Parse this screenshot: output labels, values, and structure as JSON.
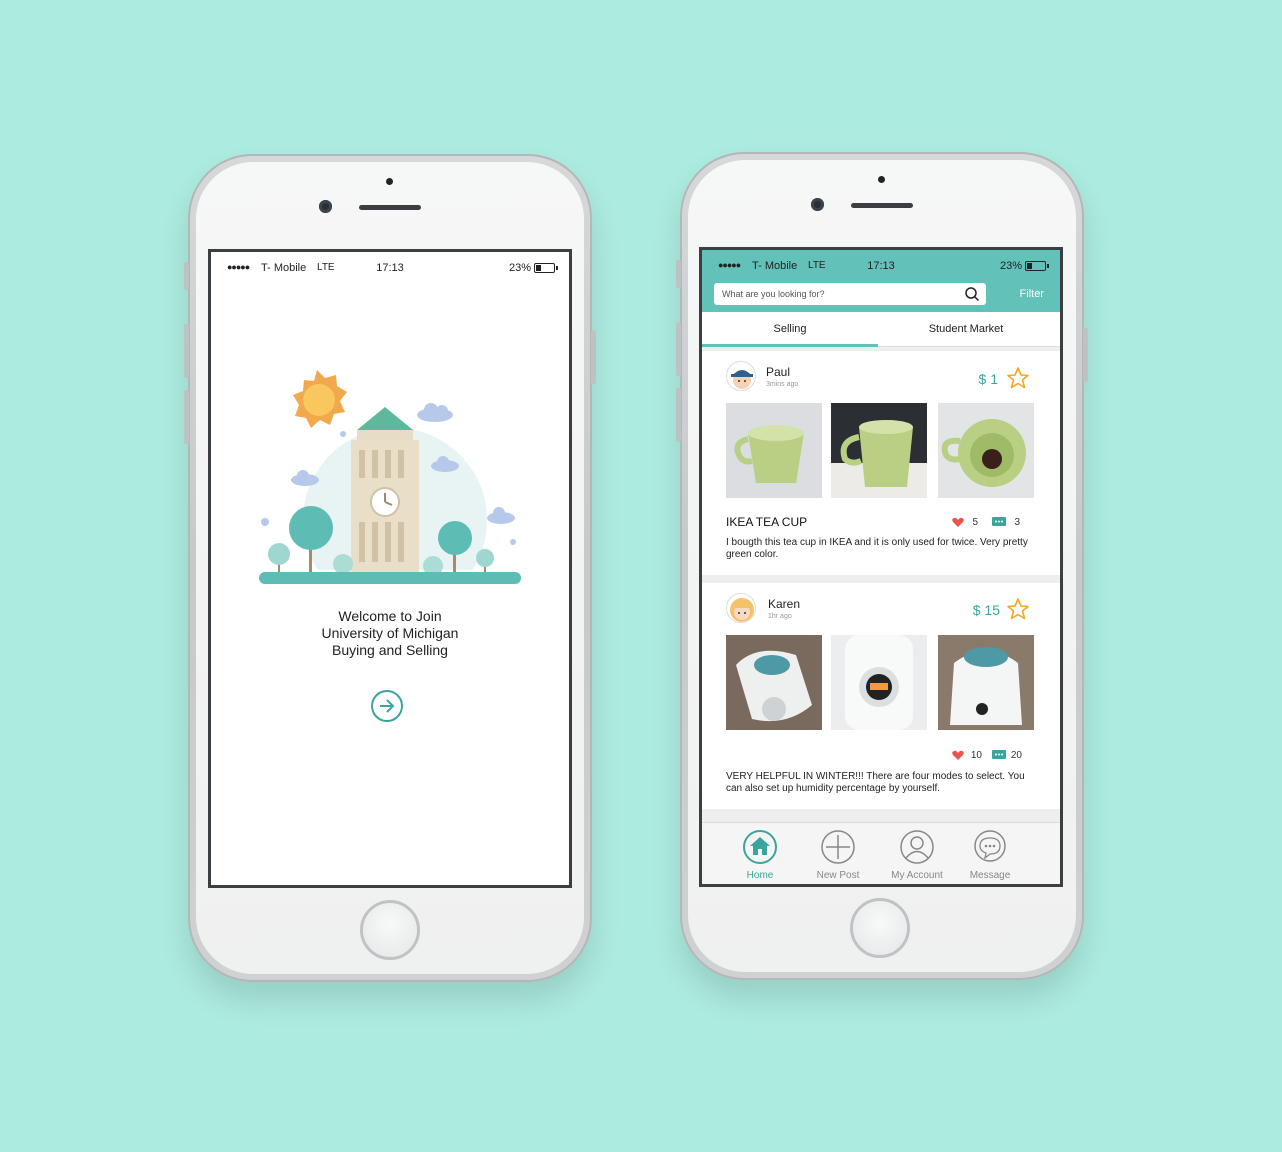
{
  "status": {
    "carrier": "T- Mobile",
    "network": "LTE",
    "time": "17:13",
    "battery": "23%"
  },
  "welcome": {
    "line1": "Welcome to Join",
    "line2": "University of Michigan",
    "line3": "Buying and Selling",
    "next_icon": "arrow-right-circle-icon"
  },
  "market": {
    "search_placeholder": "What are you looking for?",
    "filter_label": "Filter",
    "tabs": [
      {
        "label": "Selling",
        "active": true
      },
      {
        "label": "Student Market",
        "active": false
      }
    ],
    "posts": [
      {
        "user": "Paul",
        "time_ago": "3mins ago",
        "price": "$ 1",
        "title": "IKEA TEA CUP",
        "likes": "5",
        "comments": "3",
        "description": "I bougth this tea cup in IKEA and it is only used for twice. Very pretty green color."
      },
      {
        "user": "Karen",
        "time_ago": "1hr ago",
        "price": "$ 15",
        "title": "",
        "likes": "10",
        "comments": "20",
        "description": "VERY HELPFUL IN WINTER!!! There are four modes to select. You can also set up humidity percentage by yourself."
      }
    ],
    "tabbar": [
      {
        "label": "Home",
        "icon": "home-icon",
        "active": true
      },
      {
        "label": "New Post",
        "icon": "plus-circle-icon",
        "active": false
      },
      {
        "label": "My Account",
        "icon": "user-icon",
        "active": false
      },
      {
        "label": "Message",
        "icon": "chat-icon",
        "active": false
      }
    ]
  },
  "colors": {
    "background": "#acebdf",
    "accent": "#62c1b8",
    "accent_dark": "#3aa59c",
    "star": "#f5a623",
    "heart": "#e8554e"
  }
}
